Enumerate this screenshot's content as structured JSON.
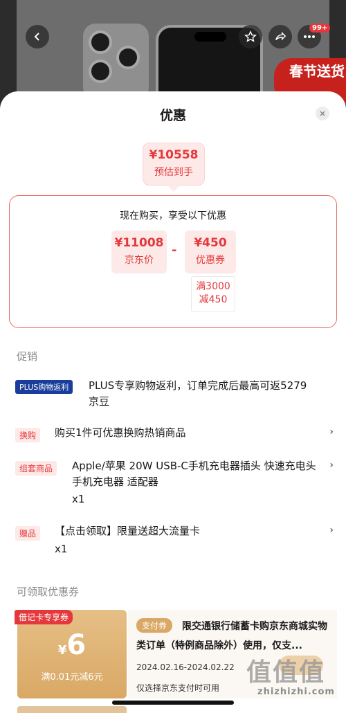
{
  "background": {
    "badge": "99+",
    "banner": "春节送货"
  },
  "sheet": {
    "title": "优惠",
    "close_icon": "close-icon"
  },
  "estimate": {
    "price": "¥10558",
    "label": "预估到手"
  },
  "detail": {
    "title": "现在购买，享受以下优惠",
    "jd_price": "¥11008",
    "jd_label": "京东价",
    "minus": "-",
    "coupon_price": "¥450",
    "coupon_label": "优惠券",
    "cond_line1": "满3000",
    "cond_line2": "减450"
  },
  "promotions": {
    "section_title": "促销",
    "items": [
      {
        "tag": "PLUS购物返利",
        "text": "PLUS专享购物返利，订单完成后最高可返5279京豆"
      },
      {
        "tag": "换购",
        "text": "购买1件可优惠换购热销商品",
        "chevron": "›"
      },
      {
        "tag": "组套商品",
        "text": "Apple/苹果 20W USB-C手机充电器插头 快速充电头 手机充电器 适配器",
        "qty": "x1",
        "chevron": "›"
      },
      {
        "tag": "赠品",
        "text": "【点击领取】限量送超大流量卡",
        "qty": "x1",
        "chevron": "›"
      }
    ]
  },
  "coupons": {
    "section_title": "可领取优惠券",
    "items": [
      {
        "tag": "借记卡专享券",
        "currency": "¥",
        "amount": "6",
        "condition": "满0.01元减6元",
        "pay_tag": "支付券",
        "desc": "限交通银行储蓄卡购京东商城实物类订单（特例商品除外）使用，仅支...",
        "date": "2024.02.16-2024.02.22",
        "note": "仅选择京东支付时可用"
      }
    ]
  },
  "watermark": {
    "icon": "值值值",
    "text": "zhizhizhi.com"
  },
  "colors": {
    "accent": "#e4393c",
    "coupon_gold": "#d9a865",
    "plus_blue": "#1a3d9c"
  }
}
